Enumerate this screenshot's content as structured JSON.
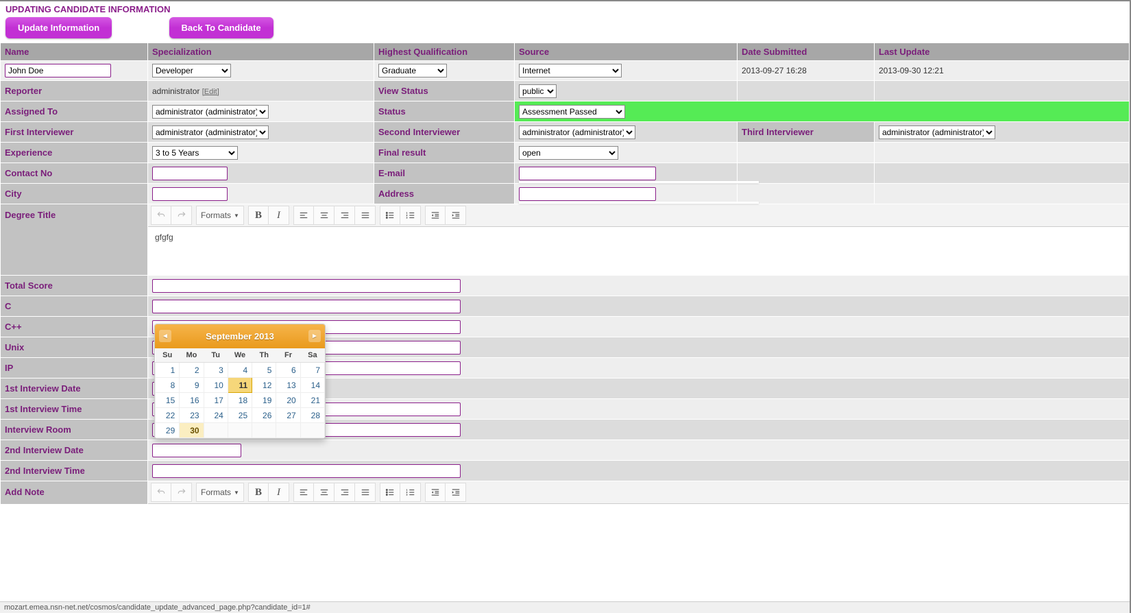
{
  "title": "UPDATING CANDIDATE INFORMATION",
  "buttons": {
    "update": "Update Information",
    "back": "Back To Candidate"
  },
  "headers": {
    "name": "Name",
    "specialization": "Specialization",
    "qualification": "Highest Qualification",
    "source": "Source",
    "date_submitted": "Date Submitted",
    "last_update": "Last Update"
  },
  "labels": {
    "reporter": "Reporter",
    "view_status": "View Status",
    "assigned_to": "Assigned To",
    "status": "Status",
    "first_interviewer": "First Interviewer",
    "second_interviewer": "Second Interviewer",
    "third_interviewer": "Third Interviewer",
    "experience": "Experience",
    "final_result": "Final result",
    "contact_no": "Contact No",
    "email": "E-mail",
    "city": "City",
    "address": "Address",
    "degree_title": "Degree Title",
    "total_score": "Total Score",
    "c": "C",
    "cpp": "C++",
    "unix": "Unix",
    "ip": "IP",
    "i1_date": "1st Interview Date",
    "i1_time": "1st Interview Time",
    "room": "Interview Room",
    "i2_date": "2nd Interview Date",
    "i2_time": "2nd Interview Time",
    "add_note": "Add Note"
  },
  "values": {
    "name": "John Doe",
    "specialization": "Developer",
    "qualification": "Graduate",
    "source": "Internet",
    "date_submitted": "2013-09-27 16:28",
    "last_update": "2013-09-30 12:21",
    "reporter": "administrator",
    "reporter_edit": "[Edit]",
    "view_status": "public",
    "assigned_to": "administrator (administrator)",
    "status": "Assessment Passed",
    "first_interviewer": "administrator (administrator)",
    "second_interviewer": "administrator (administrator)",
    "third_interviewer": "administrator (administrator)",
    "experience": "3 to 5 Years",
    "final_result": "open",
    "contact_no": "",
    "email": "",
    "city": "",
    "address": "",
    "degree_content": "gfgfg",
    "total_score": "",
    "c": "",
    "cpp": "",
    "unix": "",
    "ip": "",
    "i1_date": "",
    "i1_time": "",
    "room": "",
    "i2_date": "",
    "i2_time": ""
  },
  "rte": {
    "formats": "Formats"
  },
  "calendar": {
    "title": "September 2013",
    "dow": [
      "Su",
      "Mo",
      "Tu",
      "We",
      "Th",
      "Fr",
      "Sa"
    ],
    "weeks": [
      [
        1,
        2,
        3,
        4,
        5,
        6,
        7
      ],
      [
        8,
        9,
        10,
        11,
        12,
        13,
        14
      ],
      [
        15,
        16,
        17,
        18,
        19,
        20,
        21
      ],
      [
        22,
        23,
        24,
        25,
        26,
        27,
        28
      ],
      [
        29,
        30,
        null,
        null,
        null,
        null,
        null
      ]
    ],
    "highlight": 11,
    "today": 30
  },
  "statusbar": "mozart.emea.nsn-net.net/cosmos/candidate_update_advanced_page.php?candidate_id=1#"
}
